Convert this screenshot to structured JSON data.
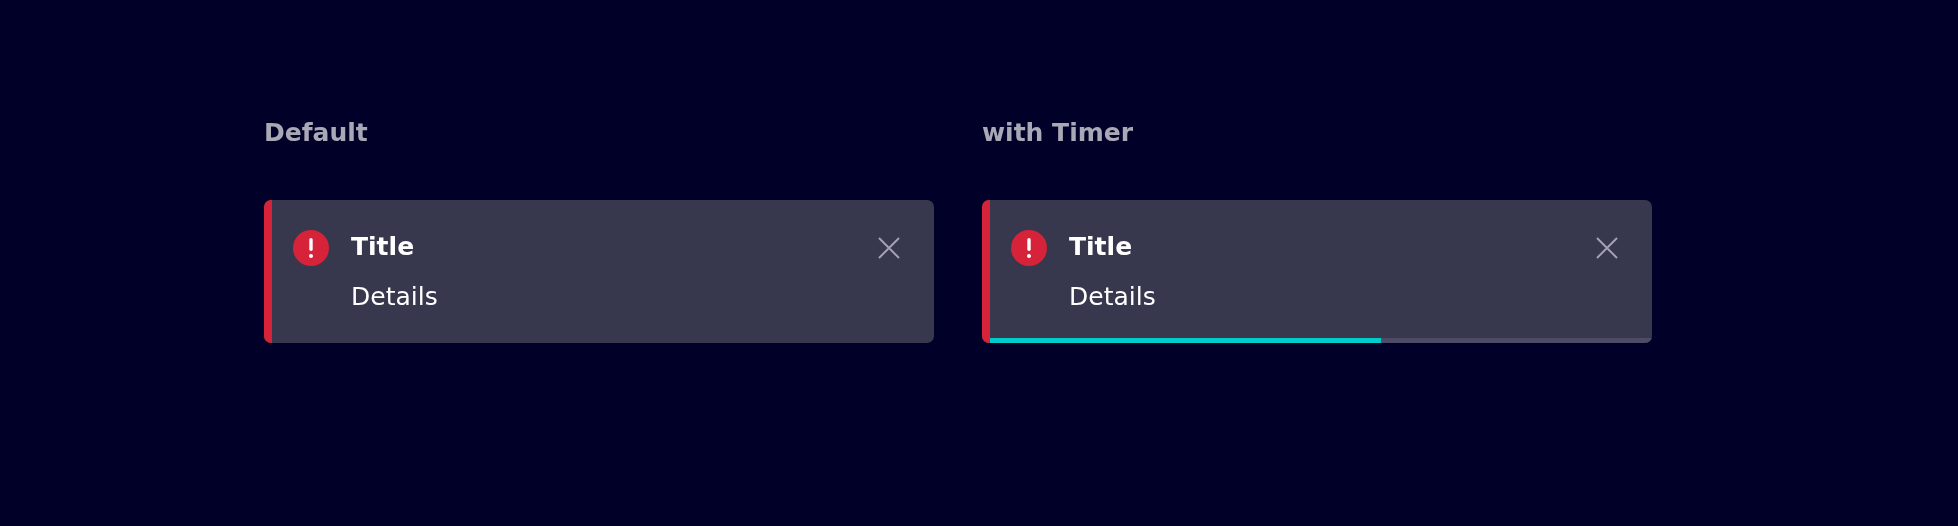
{
  "toasts": [
    {
      "heading": "Default",
      "kind": "plain",
      "title": "Title",
      "details": "Details"
    },
    {
      "heading": "with Timer",
      "kind": "timer",
      "title": "Title",
      "details": "Details",
      "timer": {
        "level": 0.59
      }
    }
  ]
}
